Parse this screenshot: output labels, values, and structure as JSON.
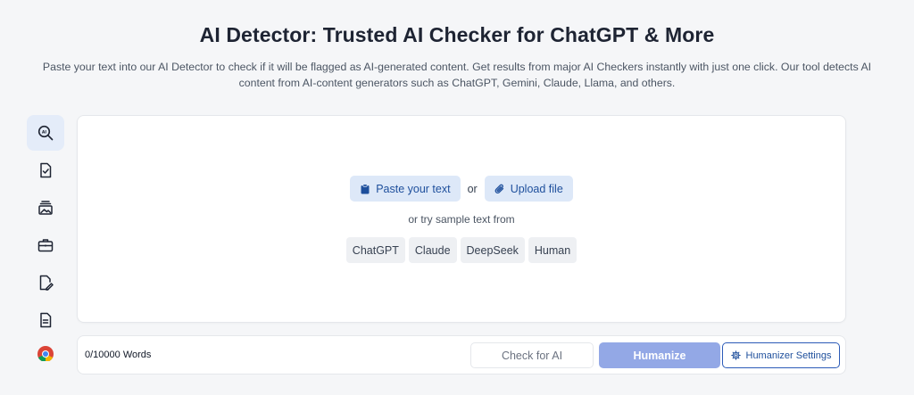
{
  "header": {
    "title": "AI Detector: Trusted AI Checker for ChatGPT & More",
    "subtitle": "Paste your text into our AI Detector to check if it will be flagged as AI-generated content. Get results from major AI Checkers instantly with just one click. Our tool detects AI content from AI-content generators such as ChatGPT, Gemini, Claude, Llama, and others."
  },
  "sidebar": {
    "items": [
      {
        "icon": "ai-search-icon",
        "active": true
      },
      {
        "icon": "document-check-icon",
        "active": false
      },
      {
        "icon": "image-stack-icon",
        "active": false
      },
      {
        "icon": "briefcase-icon",
        "active": false
      },
      {
        "icon": "document-edit-icon",
        "active": false
      },
      {
        "icon": "document-lines-icon",
        "active": false
      },
      {
        "icon": "chrome-icon",
        "active": false
      }
    ]
  },
  "editor": {
    "paste_label": "Paste your text",
    "or_label": "or",
    "upload_label": "Upload file",
    "try_label": "or try sample text from",
    "samples": [
      "ChatGPT",
      "Claude",
      "DeepSeek",
      "Human"
    ]
  },
  "toolbar": {
    "word_count": "0/10000 Words",
    "check_label": "Check for AI",
    "humanize_label": "Humanize",
    "settings_label": "Humanizer Settings"
  },
  "colors": {
    "accent": "#2c5bb8",
    "humanize_bg": "#93a8e6",
    "pill_bg": "#dde8f8",
    "active_rail_bg": "#e4ecf9"
  }
}
